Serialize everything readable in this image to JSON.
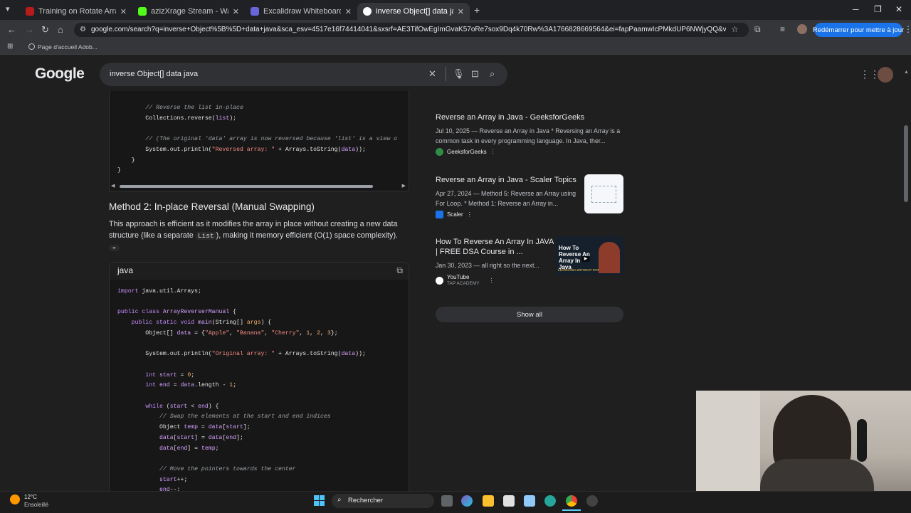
{
  "browser": {
    "tabs": [
      {
        "title": "Training on Rotate Array | Code",
        "favicon_color": "#b71c1c"
      },
      {
        "title": "azizXrage Stream - Watch Live",
        "favicon_color": "#53fc18"
      },
      {
        "title": "Excalidraw Whiteboard",
        "favicon_color": "#6965db"
      },
      {
        "title": "inverse Object[] data java - Goo",
        "favicon_color": "#ffffff",
        "active": true
      }
    ],
    "new_tab": "+",
    "url": "google.com/search?q=inverse+Object%5B%5D+data+java&sca_esv=4517e16f74414041&sxsrf=AE3TifOwEgImGvaK57oRe7sox9Dq4k70Rw%3A1766828669564&ei=fapPaamwIcPMkdUP6NWjyQQ&ved=0ahUKEwj...",
    "relaunch_label": "Redémarrer pour mettre à jour",
    "bookmark": "Page d'accueil Adob..."
  },
  "google": {
    "logo": "Google",
    "query": "inverse Object[] data java"
  },
  "answer": {
    "method_heading": "Method 2: In-place Reversal (Manual Swapping)",
    "method_text_1": "This approach is efficient as it modifies the array in place without creating a new data structure (like a separate ",
    "method_code": "List",
    "method_text_2": "), making it memory efficient (O(1) space complexity).",
    "lang_label": "java"
  },
  "right_panel": {
    "results": [
      {
        "title": "Reverse an Array in Java - GeeksforGeeks",
        "snippet": "Jul 10, 2025 — Reverse an Array in Java * Reversing an Array is a common task in every programming language. In Java, ther...",
        "source": "GeeksforGeeks",
        "source_color": "#2f8d46"
      },
      {
        "title": "Reverse an Array in Java - Scaler Topics",
        "snippet": "Apr 27, 2024 — Method 5: Reverse an Array using For Loop. * Method 1: Reverse an Array in...",
        "source": "Scaler",
        "source_color": "#1a73e8"
      },
      {
        "title": "How To Reverse An Array In JAVA | FREE DSA Course in ...",
        "snippet": "Jan 30, 2023 — all right so the next...",
        "source": "YouTube",
        "source_sub": "TAP ACADEMY",
        "source_color": "#ff0000",
        "thumb_text": "How To Reverse An Array In Java",
        "thumb_badge": "LEARN DSA WITHOUT PAIN"
      }
    ],
    "show_all": "Show all"
  },
  "taskbar": {
    "weather_temp": "12°C",
    "weather_desc": "Ensoleillé",
    "search_label": "Rechercher"
  }
}
